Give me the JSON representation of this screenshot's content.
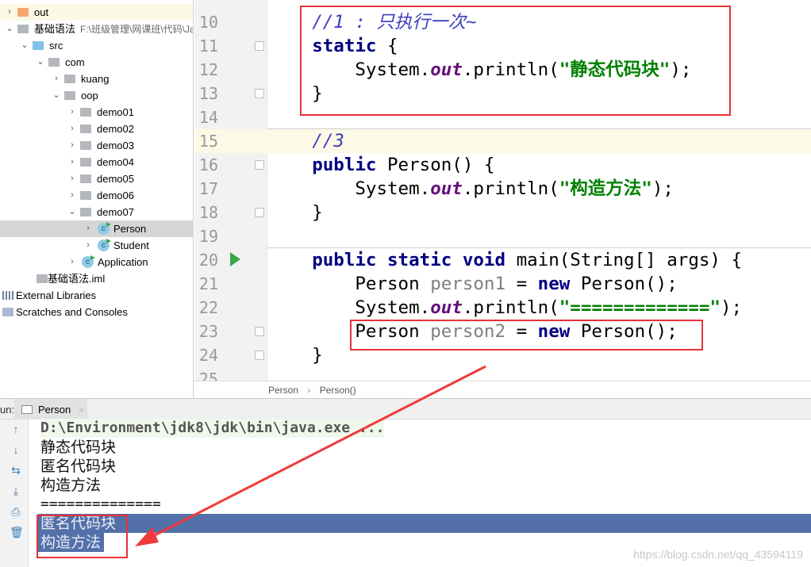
{
  "sidebar": {
    "items": [
      {
        "label": "out",
        "arrow": "›",
        "icon": "folder-orange"
      },
      {
        "label": "基础语法",
        "path": "F:\\班级管理\\网课班\\代码\\Ja",
        "arrow": "⌄",
        "icon": "module"
      },
      {
        "label": "src",
        "arrow": "⌄",
        "icon": "folder-blue"
      },
      {
        "label": "com",
        "arrow": "⌄",
        "icon": "package"
      },
      {
        "label": "kuang",
        "arrow": "›",
        "icon": "package"
      },
      {
        "label": "oop",
        "arrow": "⌄",
        "icon": "package"
      },
      {
        "label": "demo01",
        "arrow": "›",
        "icon": "package"
      },
      {
        "label": "demo02",
        "arrow": "›",
        "icon": "package"
      },
      {
        "label": "demo03",
        "arrow": "›",
        "icon": "package"
      },
      {
        "label": "demo04",
        "arrow": "›",
        "icon": "package"
      },
      {
        "label": "demo05",
        "arrow": "›",
        "icon": "package"
      },
      {
        "label": "demo06",
        "arrow": "›",
        "icon": "package"
      },
      {
        "label": "demo07",
        "arrow": "⌄",
        "icon": "package"
      },
      {
        "label": "Person",
        "arrow": "›",
        "icon": "class",
        "selected": true
      },
      {
        "label": "Student",
        "arrow": "›",
        "icon": "class"
      },
      {
        "label": "Application",
        "arrow": "›",
        "icon": "class"
      },
      {
        "label": "基础语法.iml",
        "icon": "file"
      },
      {
        "label": "External Libraries",
        "icon": "libraries"
      },
      {
        "label": "Scratches and Consoles",
        "icon": "scratches"
      }
    ]
  },
  "editor": {
    "current_line": 15,
    "lines": [
      {
        "n": "10",
        "t": [
          [
            "    ",
            ""
          ],
          [
            "//1 : 只执行一次~",
            "cm"
          ]
        ]
      },
      {
        "n": "11",
        "t": [
          [
            "    ",
            ""
          ],
          [
            "static",
            "kw"
          ],
          [
            " {",
            ""
          ]
        ]
      },
      {
        "n": "12",
        "t": [
          [
            "        System.",
            ""
          ],
          [
            "out",
            "fld"
          ],
          [
            ".println(",
            ""
          ],
          [
            "\"静态代码块\"",
            "st"
          ],
          [
            ");",
            ""
          ]
        ]
      },
      {
        "n": "13",
        "t": [
          [
            "    }",
            ""
          ]
        ]
      },
      {
        "n": "14",
        "t": []
      },
      {
        "n": "15",
        "t": [
          [
            "    ",
            ""
          ],
          [
            "//3",
            "cm"
          ]
        ]
      },
      {
        "n": "16",
        "t": [
          [
            "    ",
            ""
          ],
          [
            "public",
            "kw"
          ],
          [
            " Person() {",
            ""
          ]
        ]
      },
      {
        "n": "17",
        "t": [
          [
            "        System.",
            ""
          ],
          [
            "out",
            "fld"
          ],
          [
            ".println(",
            ""
          ],
          [
            "\"构造方法\"",
            "st"
          ],
          [
            ");",
            ""
          ]
        ]
      },
      {
        "n": "18",
        "t": [
          [
            "    }",
            ""
          ]
        ]
      },
      {
        "n": "19",
        "t": []
      },
      {
        "n": "20",
        "t": [
          [
            "    ",
            ""
          ],
          [
            "public static void",
            "kw"
          ],
          [
            " main(String[] args) {",
            ""
          ]
        ]
      },
      {
        "n": "21",
        "t": [
          [
            "        Person ",
            ""
          ],
          [
            "person1",
            "un"
          ],
          [
            " = ",
            ""
          ],
          [
            "new",
            "kw"
          ],
          [
            " Person();",
            ""
          ]
        ]
      },
      {
        "n": "22",
        "t": [
          [
            "        System.",
            ""
          ],
          [
            "out",
            "fld"
          ],
          [
            ".println(",
            ""
          ],
          [
            "\"=============\"",
            "st"
          ],
          [
            ");",
            ""
          ]
        ]
      },
      {
        "n": "23",
        "t": [
          [
            "        Person ",
            ""
          ],
          [
            "person2",
            "un"
          ],
          [
            " = ",
            ""
          ],
          [
            "new",
            "kw"
          ],
          [
            " Person();",
            ""
          ]
        ]
      },
      {
        "n": "24",
        "t": [
          [
            "    }",
            ""
          ]
        ]
      },
      {
        "n": "25",
        "t": []
      }
    ]
  },
  "breadcrumb": {
    "items": [
      "Person",
      "Person()"
    ],
    "separator": "›"
  },
  "run": {
    "label": "un:",
    "tab": "Person",
    "close": "×"
  },
  "console": {
    "lines": [
      "D:\\Environment\\jdk8\\jdk\\bin\\java.exe ...",
      "静态代码块",
      "匿名代码块",
      "构造方法",
      "==============",
      "匿名代码块",
      "构造方法"
    ]
  },
  "watermark": "https://blog.csdn.net/qq_43594119",
  "colors": {
    "annotation": "#e5333a",
    "selection": "#5370a8",
    "keyword": "#000080",
    "string": "#008000"
  }
}
